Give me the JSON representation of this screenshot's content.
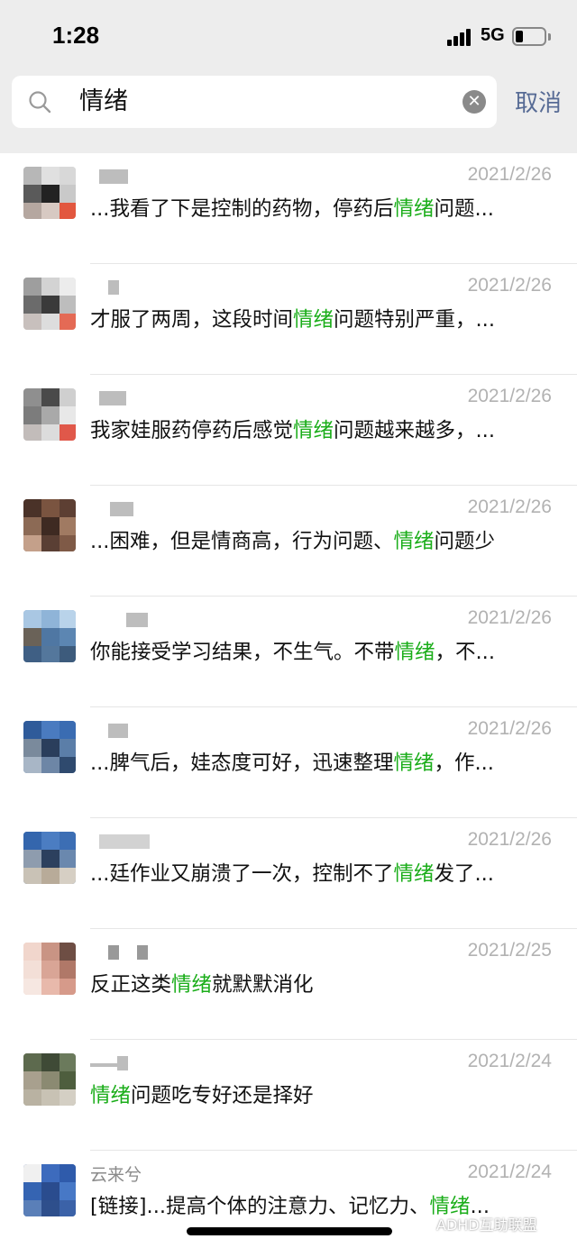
{
  "status_bar": {
    "time": "1:28",
    "network": "5G"
  },
  "search": {
    "query": "情绪",
    "cancel_label": "取消"
  },
  "results": [
    {
      "name": "",
      "date": "2021/2/26",
      "pre": "...我看了下是控制的药物，停药后",
      "hl": "情绪",
      "post": "问题..."
    },
    {
      "name": "",
      "date": "2021/2/26",
      "pre": "才服了两周，这段时间",
      "hl": "情绪",
      "post": "问题特别严重，..."
    },
    {
      "name": "",
      "date": "2021/2/26",
      "pre": "我家娃服药停药后感觉",
      "hl": "情绪",
      "post": "问题越来越多，..."
    },
    {
      "name": "",
      "date": "2021/2/26",
      "pre": "...困难，但是情商高，行为问题、",
      "hl": "情绪",
      "post": "问题少"
    },
    {
      "name": "",
      "date": "2021/2/26",
      "pre": "你能接受学习结果，不生气。不带",
      "hl": "情绪",
      "post": "，不..."
    },
    {
      "name": "",
      "date": "2021/2/26",
      "pre": "...脾气后，娃态度可好，迅速整理",
      "hl": "情绪",
      "post": "，作..."
    },
    {
      "name": "",
      "date": "2021/2/26",
      "pre": "...廷作业又崩溃了一次，控制不了",
      "hl": "情绪",
      "post": "发了..."
    },
    {
      "name": "",
      "date": "2021/2/25",
      "pre": "反正这类",
      "hl": "情绪",
      "post": "就默默消化"
    },
    {
      "name": "",
      "date": "2021/2/24",
      "pre": "",
      "hl": "情绪",
      "post": "问题吃专好还是择好"
    },
    {
      "name": "云来兮",
      "date": "2021/2/24",
      "pre": "[链接]...提高个体的注意力、记忆力、",
      "hl": "情绪",
      "post": "..."
    }
  ],
  "watermark": "ADHD互助联盟",
  "colors": {
    "highlight": "#1aad19",
    "cancel": "#576b95",
    "date": "#b2b2b2"
  },
  "icons": [
    "search-icon",
    "clear-icon",
    "signal-icon",
    "battery-icon"
  ]
}
